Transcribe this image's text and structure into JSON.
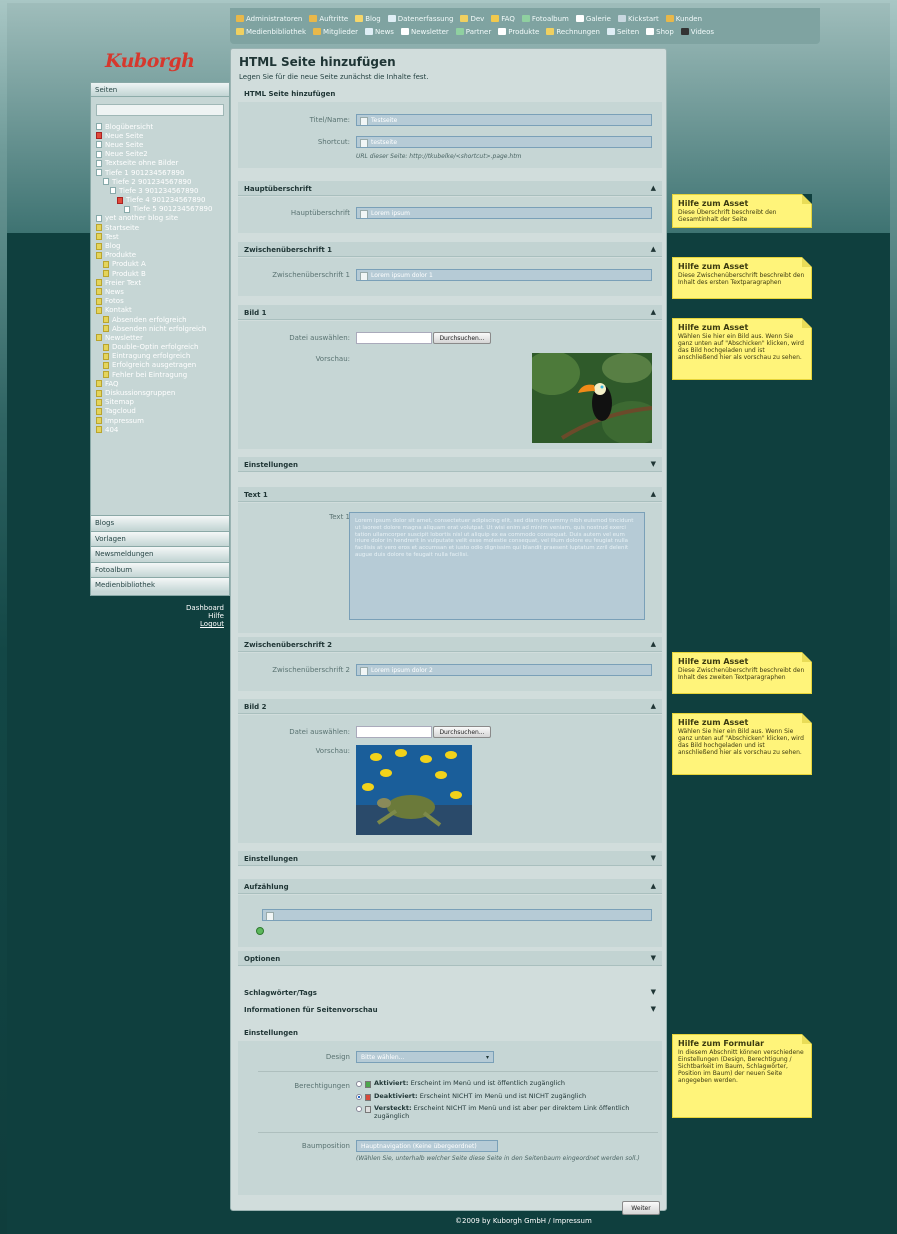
{
  "nav": {
    "row1": [
      {
        "label": "Administratoren",
        "icon": "users-icon",
        "color": "#e8b84a"
      },
      {
        "label": "Auftritte",
        "icon": "users-icon",
        "color": "#e8b84a"
      },
      {
        "label": "Blog",
        "icon": "blog-icon",
        "color": "#f5d66a"
      },
      {
        "label": "Datenerfassung",
        "icon": "form-icon",
        "color": "#dfeef5"
      },
      {
        "label": "Dev",
        "icon": "folder-icon",
        "color": "#f0d060"
      },
      {
        "label": "FAQ",
        "icon": "faq-icon",
        "color": "#f2c94c"
      },
      {
        "label": "Fotoalbum",
        "icon": "photo-icon",
        "color": "#8fd0a0"
      },
      {
        "label": "Galerie",
        "icon": "gallery-icon",
        "color": "#ffffff"
      },
      {
        "label": "Kickstart",
        "icon": "kickstart-icon",
        "color": "#c9d8e0"
      },
      {
        "label": "Kunden",
        "icon": "users-icon",
        "color": "#e8b84a"
      }
    ],
    "row2": [
      {
        "label": "Medienbibliothek",
        "icon": "media-icon",
        "color": "#f0d060"
      },
      {
        "label": "Mitglieder",
        "icon": "users-icon",
        "color": "#e8b84a"
      },
      {
        "label": "News",
        "icon": "news-icon",
        "color": "#dfeef5"
      },
      {
        "label": "Newsletter",
        "icon": "mail-icon",
        "color": "#ffffff"
      },
      {
        "label": "Partner",
        "icon": "partner-icon",
        "color": "#8fd0a0"
      },
      {
        "label": "Produkte",
        "icon": "box-icon",
        "color": "#ffffff"
      },
      {
        "label": "Rechnungen",
        "icon": "invoice-icon",
        "color": "#f0d060"
      },
      {
        "label": "Seiten",
        "icon": "pages-icon",
        "color": "#dfeef5"
      },
      {
        "label": "Shop",
        "icon": "shop-icon",
        "color": "#ffffff"
      },
      {
        "label": "Videos",
        "icon": "video-icon",
        "color": "#333333"
      }
    ]
  },
  "logo": "Kuborgh",
  "sidebar": {
    "header": "Seiten",
    "tree": [
      {
        "label": "Blogübersicht",
        "indent": 0,
        "type": "page"
      },
      {
        "label": "Neue Seite",
        "indent": 0,
        "type": "red"
      },
      {
        "label": "Neue Seite",
        "indent": 0,
        "type": "page"
      },
      {
        "label": "Neue Seite2",
        "indent": 0,
        "type": "page"
      },
      {
        "label": "Textseite ohne Bilder",
        "indent": 0,
        "type": "page"
      },
      {
        "label": "Tiefe 1 901234567890",
        "indent": 0,
        "type": "page"
      },
      {
        "label": "Tiefe 2 901234567890",
        "indent": 1,
        "type": "page"
      },
      {
        "label": "Tiefe 3 901234567890",
        "indent": 2,
        "type": "page"
      },
      {
        "label": "Tiefe 4 901234567890",
        "indent": 3,
        "type": "red"
      },
      {
        "label": "Tiefe 5 901234567890",
        "indent": 4,
        "type": "page"
      },
      {
        "label": "yet another blog site",
        "indent": 0,
        "type": "page"
      },
      {
        "label": "Startseite",
        "indent": 0,
        "type": "folder"
      },
      {
        "label": "Test",
        "indent": 0,
        "type": "folder"
      },
      {
        "label": "Blog",
        "indent": 0,
        "type": "folder"
      },
      {
        "label": "Produkte",
        "indent": 0,
        "type": "folder"
      },
      {
        "label": "Produkt A",
        "indent": 1,
        "type": "folder"
      },
      {
        "label": "Produkt B",
        "indent": 1,
        "type": "folder"
      },
      {
        "label": "Freier Text",
        "indent": 0,
        "type": "folder"
      },
      {
        "label": "News",
        "indent": 0,
        "type": "folder"
      },
      {
        "label": "Fotos",
        "indent": 0,
        "type": "folder"
      },
      {
        "label": "Kontakt",
        "indent": 0,
        "type": "folder"
      },
      {
        "label": "Absenden erfolgreich",
        "indent": 1,
        "type": "folder"
      },
      {
        "label": "Absenden nicht erfolgreich",
        "indent": 1,
        "type": "folder"
      },
      {
        "label": "Newsletter",
        "indent": 0,
        "type": "folder"
      },
      {
        "label": "Double-Optin erfolgreich",
        "indent": 1,
        "type": "folder"
      },
      {
        "label": "Eintragung erfolgreich",
        "indent": 1,
        "type": "folder"
      },
      {
        "label": "Erfolgreich ausgetragen",
        "indent": 1,
        "type": "folder"
      },
      {
        "label": "Fehler bei Eintragung",
        "indent": 1,
        "type": "folder"
      },
      {
        "label": "FAQ",
        "indent": 0,
        "type": "folder"
      },
      {
        "label": "Diskussionsgruppen",
        "indent": 0,
        "type": "folder"
      },
      {
        "label": "Sitemap",
        "indent": 0,
        "type": "folder"
      },
      {
        "label": "Tagcloud",
        "indent": 0,
        "type": "folder"
      },
      {
        "label": "Impressum",
        "indent": 0,
        "type": "folder"
      },
      {
        "label": "404",
        "indent": 0,
        "type": "folder"
      }
    ],
    "sections": [
      "Blogs",
      "Vorlagen",
      "Newsmeldungen",
      "Fotoalbum",
      "Medienbibliothek"
    ]
  },
  "links": [
    "Dashboard",
    "Hilfe",
    "Logout"
  ],
  "page": {
    "title": "HTML Seite hinzufügen",
    "description": "Legen Sie für die neue Seite zunächst die Inhalte fest.",
    "basic": {
      "heading": "HTML Seite hinzufügen",
      "title_label": "Titel/Name:",
      "title_value": "Testseite",
      "shortcut_label": "Shortcut:",
      "shortcut_value": "testseite",
      "url_note": "URL dieser Seite: http://tkubelke/<shortcut>.page.htm"
    },
    "haupt": {
      "heading": "Hauptüberschrift",
      "label": "Hauptüberschrift",
      "value": "Lorem ipsum"
    },
    "zwischen1": {
      "heading": "Zwischenüberschrift 1",
      "label": "Zwischenüberschrift 1",
      "value": "Lorem ipsum dolor 1"
    },
    "bild1": {
      "heading": "Bild 1",
      "file_label": "Datei auswählen:",
      "browse": "Durchsuchen...",
      "preview_label": "Vorschau:"
    },
    "einst1": "Einstellungen",
    "text1": {
      "heading": "Text 1",
      "label": "Text 1",
      "value": "Lorem ipsum dolor sit amet, consectetuer adipiscing elit, sed diam nonummy nibh euismod tincidunt ut laoreet dolore magna aliquam erat volutpat. Ut wisi enim ad minim veniam, quis nostrud exerci tation ullamcorper suscipit lobortis nisl ut aliquip ex ea commodo consequat. Duis autem vel eum iriure dolor in hendrerit in vulputate velit esse molestie consequat, vel illum dolore eu feugiat nulla facilisis at vero eros et accumsan et iusto odio dignissim qui blandit praesent luptatum zzril delenit augue duis dolore te feugait nulla facilisi."
    },
    "zwischen2": {
      "heading": "Zwischenüberschrift 2",
      "label": "Zwischenüberschrift 2",
      "value": "Lorem ipsum dolor 2"
    },
    "bild2": {
      "heading": "Bild 2",
      "file_label": "Datei auswählen:",
      "browse": "Durchsuchen...",
      "preview_label": "Vorschau:"
    },
    "einst2": "Einstellungen",
    "aufz": {
      "heading": "Aufzählung"
    },
    "optionen": "Optionen",
    "tags": "Schlagwörter/Tags",
    "preview_info": "Informationen für Seitenvorschau",
    "settings": {
      "heading": "Einstellungen",
      "design_label": "Design",
      "design_value": "Bitte wählen...",
      "perm_label": "Berechtigungen",
      "perm_options": [
        {
          "title": "Aktiviert:",
          "text": "Erscheint im Menü und ist öffentlich zugänglich",
          "selected": false,
          "color": "#4ca64c"
        },
        {
          "title": "Deaktiviert:",
          "text": "Erscheint NICHT im Menü und ist NICHT zugänglich",
          "selected": true,
          "color": "#d84a3a"
        },
        {
          "title": "Versteckt:",
          "text": "Erscheint NICHT im Menü und ist aber per direktem Link öffentlich zugänglich",
          "selected": false,
          "color": "#dddddd"
        }
      ],
      "tree_label": "Baumposition",
      "tree_value": "Hauptnavigation (Keine übergeordnet)",
      "tree_note": "(Wählen Sie, unterhalb welcher Seite diese Seite in den Seitenbaum eingeordnet werden soll.)"
    },
    "next": "Weiter"
  },
  "help": {
    "h1": {
      "title": "Hilfe zum Asset",
      "text": "Diese Überschrift beschreibt den Gesamtinhalt der Seite"
    },
    "h2": {
      "title": "Hilfe zum Asset",
      "text": "Diese Zwischenüberschrift beschreibt den Inhalt des ersten Textparagraphen"
    },
    "h3": {
      "title": "Hilfe zum Asset",
      "text": "Wählen Sie hier ein Bild aus. Wenn Sie ganz unten auf \"Abschicken\" klicken, wird das Bild hochgeladen und ist anschließend hier als vorschau zu sehen."
    },
    "h4": {
      "title": "Hilfe zum Asset",
      "text": "Diese Zwischenüberschrift beschreibt den Inhalt des zweiten Textparagraphen"
    },
    "h5": {
      "title": "Hilfe zum Asset",
      "text": "Wählen Sie hier ein Bild aus. Wenn Sie ganz unten auf \"Abschicken\" klicken, wird das Bild hochgeladen und ist anschließend hier als vorschau zu sehen."
    },
    "h6": {
      "title": "Hilfe zum Formular",
      "text": "In diesem Abschnitt können verschiedene Einstellungen (Design, Berechtigung / Sichtbarkeit im Baum, Schlagwörter, Position im Baum) der neuen Seite angegeben werden."
    }
  },
  "footer": "©2009 by Kuborgh GmbH / Impressum"
}
